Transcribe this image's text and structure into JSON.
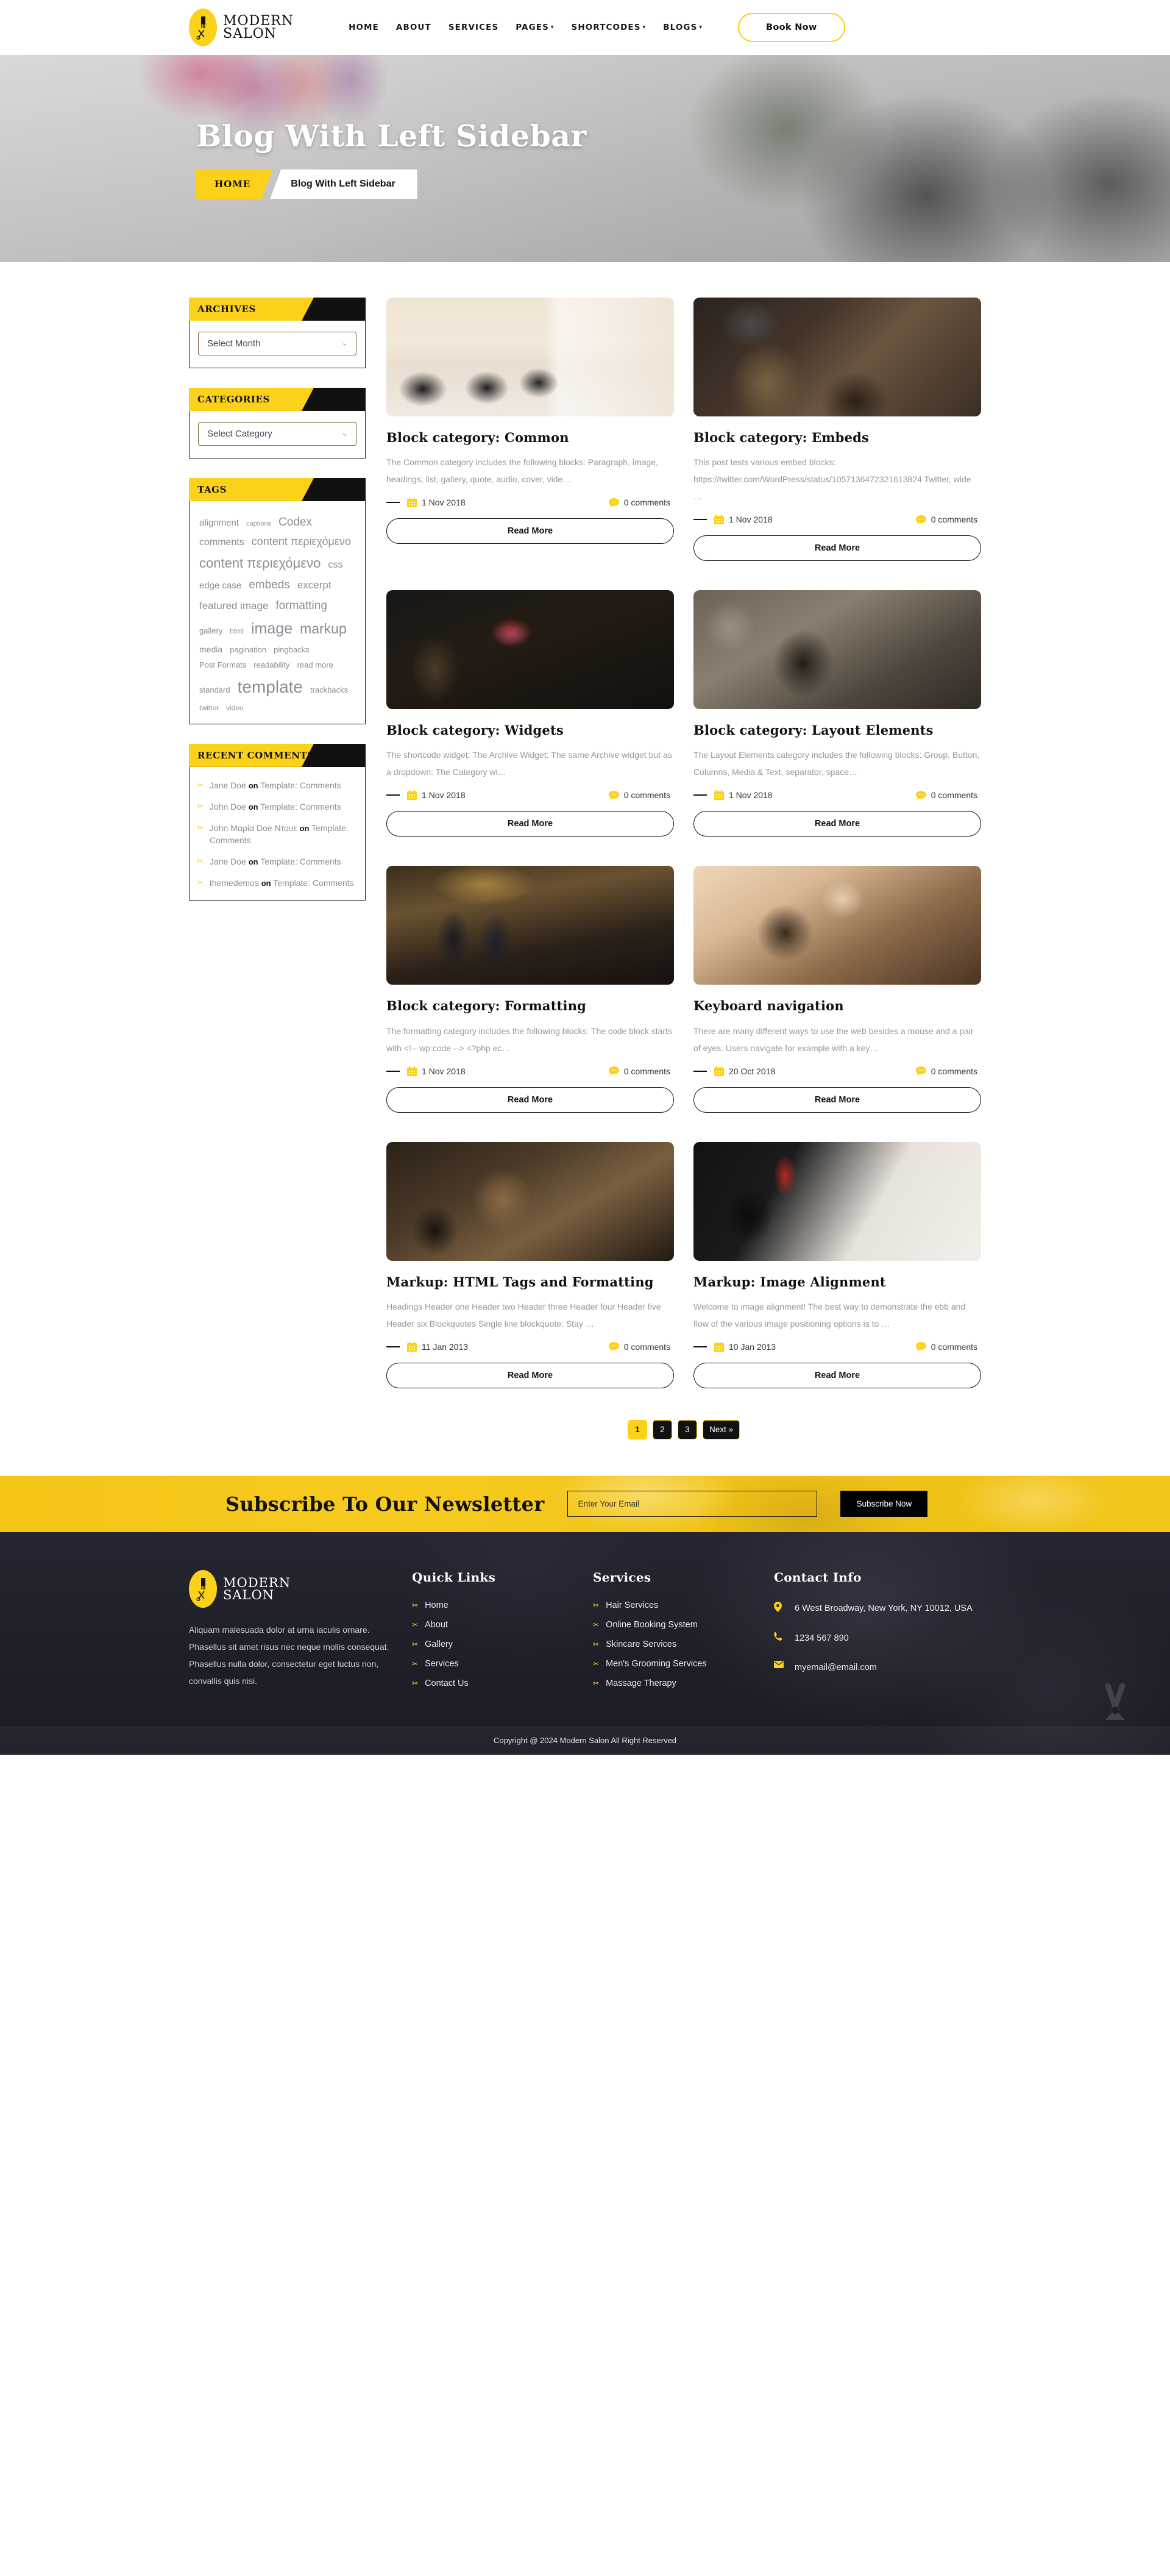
{
  "header": {
    "brand": {
      "line1": "MODERN",
      "line2": "SALON",
      "icon": "comb-scissors-icon"
    },
    "nav": [
      {
        "label": "HOME",
        "caret": false
      },
      {
        "label": "ABOUT",
        "caret": false
      },
      {
        "label": "SERVICES",
        "caret": false
      },
      {
        "label": "PAGES",
        "caret": true
      },
      {
        "label": "SHORTCODES",
        "caret": true
      },
      {
        "label": "BLOGS",
        "caret": true
      }
    ],
    "book_button": "Book Now"
  },
  "hero": {
    "title": "Blog With Left Sidebar",
    "breadcrumb_home": "HOME",
    "breadcrumb_current": "Blog With Left Sidebar"
  },
  "sidebar": {
    "archives": {
      "title": "ARCHIVES",
      "select_value": "Select Month"
    },
    "categories": {
      "title": "CATEGORIES",
      "select_value": "Select Category"
    },
    "tags": {
      "title": "TAGS",
      "items": [
        {
          "label": "alignment",
          "size": 15
        },
        {
          "label": "captions",
          "size": 11
        },
        {
          "label": "Codex",
          "size": 19
        },
        {
          "label": "comments",
          "size": 16
        },
        {
          "label": "content περιεχόμενο",
          "size": 18
        },
        {
          "label": "content περιεχόμενο",
          "size": 22
        },
        {
          "label": "css",
          "size": 16
        },
        {
          "label": "edge case",
          "size": 15
        },
        {
          "label": "embeds",
          "size": 19
        },
        {
          "label": "excerpt",
          "size": 17
        },
        {
          "label": "featured image",
          "size": 17
        },
        {
          "label": "formatting",
          "size": 19
        },
        {
          "label": "gallery",
          "size": 13
        },
        {
          "label": "html",
          "size": 12
        },
        {
          "label": "image",
          "size": 25
        },
        {
          "label": "markup",
          "size": 23
        },
        {
          "label": "media",
          "size": 14
        },
        {
          "label": "pagination",
          "size": 13
        },
        {
          "label": "pingbacks",
          "size": 13
        },
        {
          "label": "Post Formats",
          "size": 13
        },
        {
          "label": "readability",
          "size": 13
        },
        {
          "label": "read more",
          "size": 13
        },
        {
          "label": "standard",
          "size": 13
        },
        {
          "label": "template",
          "size": 28
        },
        {
          "label": "trackbacks",
          "size": 13
        },
        {
          "label": "twitter",
          "size": 12
        },
        {
          "label": "video",
          "size": 12
        }
      ]
    },
    "recent_comments": {
      "title": "RECENT COMMENTS",
      "icon": "scissors-icon",
      "items": [
        {
          "author": "Jane Doe",
          "on": "on",
          "post": "Template: Comments"
        },
        {
          "author": "John Doe",
          "on": "on",
          "post": "Template: Comments"
        },
        {
          "author": "John Μαρία Doe Ντουε",
          "on": "on",
          "post": "Template: Comments"
        },
        {
          "author": "Jane Doe",
          "on": "on",
          "post": "Template: Comments"
        },
        {
          "author": "themedemos",
          "on": "on",
          "post": "Template: Comments"
        }
      ]
    }
  },
  "posts": [
    {
      "title": "Block category: Common",
      "excerpt": "The Common category includes the following blocks: Paragraph, image, headings, list, gallery, quote, audio, cover, vide…",
      "date": "1 Nov 2018",
      "comments": "0 comments",
      "read_more": "Read More",
      "thumb_class": "ph1"
    },
    {
      "title": "Block category: Embeds",
      "excerpt": "This post tests various embed blocks: https://twitter.com/WordPress/status/1057136472321613824 Twitter,  wide …",
      "date": "1 Nov 2018",
      "comments": "0 comments",
      "read_more": "Read More",
      "thumb_class": "ph2"
    },
    {
      "title": "Block category: Widgets",
      "excerpt": "The shortcode widget: The Archive Widget: The same Archive widget but as a dropdown: The Category wi…",
      "date": "1 Nov 2018",
      "comments": "0 comments",
      "read_more": "Read More",
      "thumb_class": "ph3"
    },
    {
      "title": "Block category: Layout Elements",
      "excerpt": "The Layout Elements category includes the following blocks: Group, Button, Columns, Media & Text, separator, space…",
      "date": "1 Nov 2018",
      "comments": "0 comments",
      "read_more": "Read More",
      "thumb_class": "ph4"
    },
    {
      "title": "Block category: Formatting",
      "excerpt": "The formatting category includes the following blocks: The code block starts with <!-- wp:code -­-> <?php ec…",
      "date": "1 Nov 2018",
      "comments": "0 comments",
      "read_more": "Read More",
      "thumb_class": "ph5"
    },
    {
      "title": "Keyboard navigation",
      "excerpt": "There are many different ways to use the web besides a mouse and a pair of eyes. Users navigate for example with a key…",
      "date": "20 Oct 2018",
      "comments": "0 comments",
      "read_more": "Read More",
      "thumb_class": "ph6"
    },
    {
      "title": "Markup: HTML Tags and Formatting",
      "excerpt": "Headings Header one Header two Header three Header four Header five Header six Blockquotes Single line blockquote: Stay …",
      "date": "11 Jan 2013",
      "comments": "0 comments",
      "read_more": "Read More",
      "thumb_class": "ph7"
    },
    {
      "title": "Markup: Image Alignment",
      "excerpt": "Welcome to image alignment! The best way to demonstrate the ebb and flow of the various image positioning options is to …",
      "date": "10 Jan 2013",
      "comments": "0 comments",
      "read_more": "Read More",
      "thumb_class": "ph8"
    }
  ],
  "pagination": [
    {
      "label": "1",
      "active": true
    },
    {
      "label": "2",
      "active": false
    },
    {
      "label": "3",
      "active": false
    },
    {
      "label": "Next »",
      "active": false
    }
  ],
  "newsletter": {
    "title": "Subscribe To Our Newsletter",
    "placeholder": "Enter Your Email",
    "button": "Subscribe Now"
  },
  "footer": {
    "brand": {
      "line1": "MODERN",
      "line2": "SALON"
    },
    "about": "Aliquam malesuada dolor at urna iaculis ornare. Phasellus sit amet risus nec neque mollis consequat. Phasellus nulla dolor, consectetur eget luctus non, convallis quis nisi.",
    "quick_links": {
      "title": "Quick Links",
      "items": [
        "Home",
        "About",
        "Gallery",
        "Services",
        "Contact Us"
      ]
    },
    "services": {
      "title": "Services",
      "items": [
        "Hair Services",
        "Online Booking System",
        "Skincare Services",
        "Men's Grooming Services",
        "Massage Therapy"
      ]
    },
    "contact": {
      "title": "Contact Info",
      "address": "6 West Broadway, New York, NY 10012, USA",
      "phone": "1234 567 890",
      "email": "myemail@email.com",
      "address_icon": "location-pin-icon",
      "phone_icon": "phone-icon",
      "email_icon": "envelope-icon"
    },
    "copyright": "Copyright @ 2024 Modern Salon All Right Reserved"
  },
  "colors": {
    "accent": "#FCD11A",
    "dark": "#111111",
    "footer_bg": "#23232e"
  }
}
